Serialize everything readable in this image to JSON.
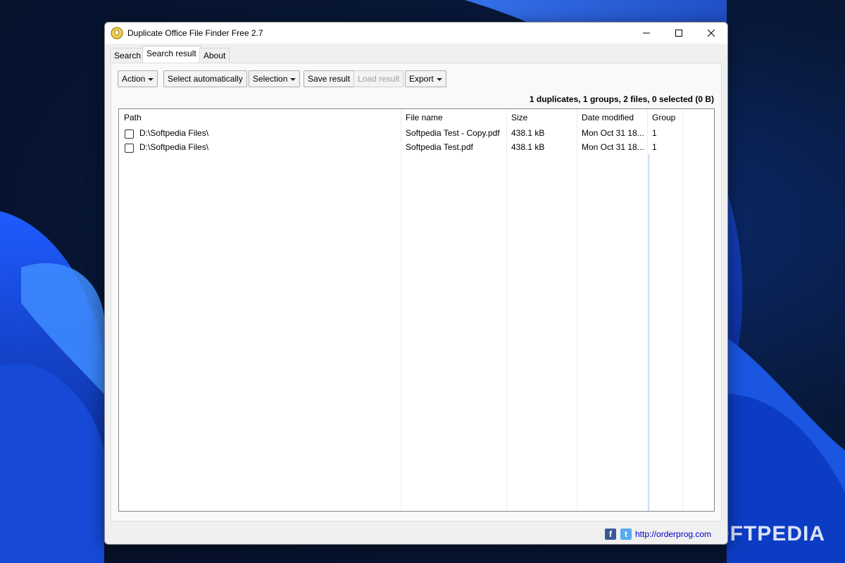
{
  "window": {
    "title": "Duplicate Office File Finder Free 2.7"
  },
  "tabs": [
    {
      "label": "Search"
    },
    {
      "label": "Search result"
    },
    {
      "label": "About"
    }
  ],
  "toolbar": {
    "action": "Action",
    "select_automatically": "Select automatically",
    "selection": "Selection",
    "save_result": "Save result",
    "load_result": "Load result",
    "export": "Export"
  },
  "summary": "1 duplicates, 1 groups, 2 files, 0 selected (0 B)",
  "table": {
    "columns": [
      "Path",
      "File name",
      "Size",
      "Date modified",
      "Group"
    ],
    "rows": [
      {
        "path": "D:\\Softpedia Files\\",
        "file_name": "Softpedia Test - Copy.pdf",
        "size": "438.1 kB",
        "date_modified": "Mon Oct 31 18...",
        "group": "1"
      },
      {
        "path": "D:\\Softpedia Files\\",
        "file_name": "Softpedia Test.pdf",
        "size": "438.1 kB",
        "date_modified": "Mon Oct 31 18...",
        "group": "1"
      }
    ]
  },
  "footer": {
    "facebook": "f",
    "twitter": "t",
    "link": "http://orderprog.com"
  },
  "watermark": "SOFTPEDIA",
  "colors": {
    "accent": "#0078d7",
    "link": "#0000cc",
    "facebook": "#3b5998",
    "twitter": "#55acee"
  }
}
